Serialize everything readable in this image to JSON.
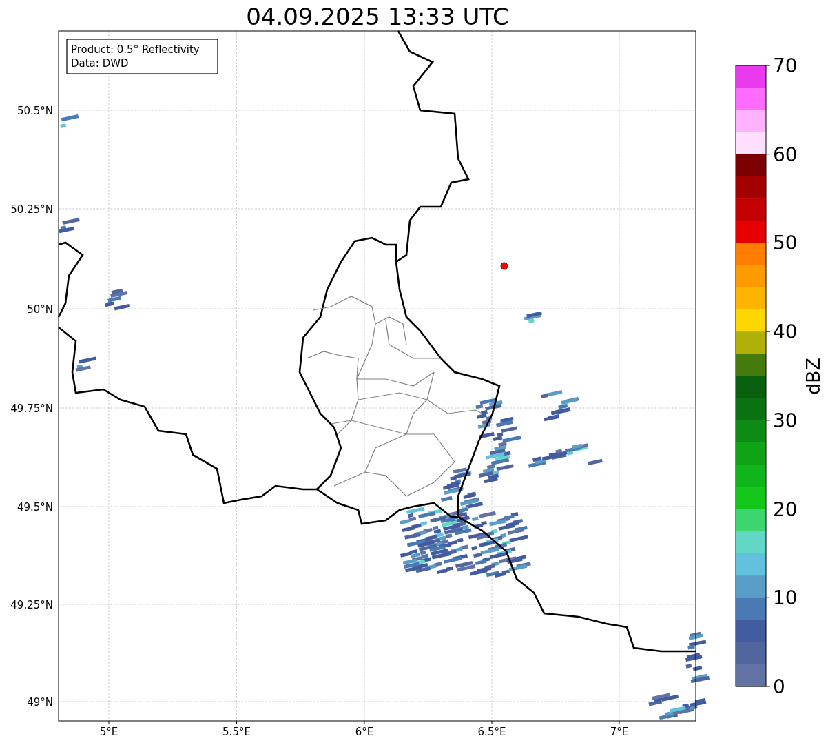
{
  "title": "04.09.2025 13:33 UTC",
  "info_box": {
    "lines": [
      "Product: 0.5° Reflectivity",
      "Data: DWD"
    ]
  },
  "map": {
    "y_ticks": [
      "50.5°N",
      "50.25°N",
      "50°N",
      "49.75°N",
      "49.5°N",
      "49.25°N",
      "49°N"
    ],
    "x_ticks": [
      "5°E",
      "5.5°E",
      "6°E",
      "6.5°E",
      "7°E"
    ]
  },
  "colorbar": {
    "label": "dBZ",
    "ticks": [
      "70",
      "60",
      "50",
      "40",
      "30",
      "20",
      "10",
      "0"
    ],
    "segments": [
      {
        "color": "#e93aed"
      },
      {
        "color": "#ff6cff"
      },
      {
        "color": "#ffb3ff"
      },
      {
        "color": "#ffdfff"
      },
      {
        "color": "#7d0000"
      },
      {
        "color": "#a30000"
      },
      {
        "color": "#c40000"
      },
      {
        "color": "#e60000"
      },
      {
        "color": "#ff7d00"
      },
      {
        "color": "#ff9b00"
      },
      {
        "color": "#ffb400"
      },
      {
        "color": "#ffd700"
      },
      {
        "color": "#b0b009"
      },
      {
        "color": "#457a0c"
      },
      {
        "color": "#08600f"
      },
      {
        "color": "#0b7213"
      },
      {
        "color": "#0d8b14"
      },
      {
        "color": "#0fa416"
      },
      {
        "color": "#10b51c"
      },
      {
        "color": "#12c71a"
      },
      {
        "color": "#3dd56e"
      },
      {
        "color": "#62d7c6"
      },
      {
        "color": "#62c1dc"
      },
      {
        "color": "#589ec7"
      },
      {
        "color": "#4a7ab3"
      },
      {
        "color": "#435ca0"
      },
      {
        "color": "#52669e"
      },
      {
        "color": "#6272a4"
      }
    ]
  }
}
